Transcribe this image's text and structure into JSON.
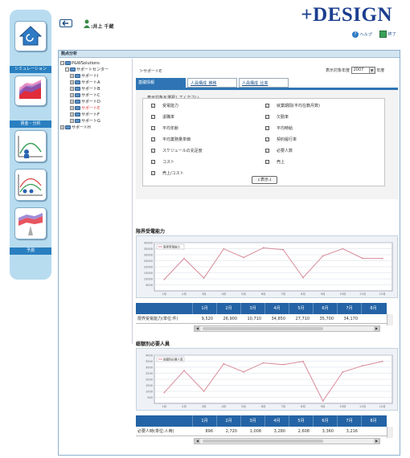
{
  "header": {
    "logo": "+DESIGN",
    "user_name": "井上 千蔵",
    "help_label": "ヘルプ",
    "exit_label": "終了"
  },
  "sidebar": {
    "simulation_label": "シミュレーション",
    "salary_label": "賃金・分析",
    "forecast_label": "予測"
  },
  "main": {
    "title": "拠点分析",
    "breadcrumb": "＞サポートE",
    "year_label": "表示対象年度",
    "year_value": "2007",
    "year_suffix": "年度"
  },
  "tree": {
    "root": "P&WSolutions",
    "center": "サポートセンター",
    "items": [
      "サポートI",
      "サポートA",
      "サポートB",
      "サポートC",
      "サポートD",
      "サポートE",
      "サポートF",
      "サポートG"
    ],
    "last": "サポートH"
  },
  "tabs": [
    "基礎情報",
    "人員構成_推移",
    "人員構成_比率"
  ],
  "options": {
    "legend": "表示対象を選択してください",
    "left": [
      "受電能力",
      "退職率",
      "平均年齢",
      "平均業務量単価",
      "スケジュールの充足度",
      "コスト",
      "売上/コスト"
    ],
    "right": [
      "就業期間(平均在籍月数)",
      "欠勤率",
      "平均時給",
      "契約履行率",
      "必要人数",
      "売上"
    ],
    "display_button": "↓表示↓"
  },
  "section1": {
    "title": "限界受電能力",
    "legend": "限界受電能力",
    "row_label": "限界受電能力(単位:件)"
  },
  "section2": {
    "title": "総額別必要人員",
    "legend": "総額別必要人員",
    "row_label": "必要人時(単位:人時)"
  },
  "months": [
    "1月",
    "2月",
    "3月",
    "4月",
    "5月",
    "6月",
    "7月",
    "8月"
  ],
  "colors": {
    "accent": "#2463a5",
    "line": "#d88a98",
    "logo": "#1b3e8f"
  },
  "chart_data": [
    {
      "type": "line",
      "title": "限界受電能力",
      "categories": [
        "1月",
        "2月",
        "3月",
        "4月",
        "5月",
        "6月",
        "7月",
        "8月",
        "9月",
        "10月",
        "11月",
        "12月"
      ],
      "values": [
        9520,
        26900,
        10710,
        34850,
        27710,
        35700,
        34170,
        11000,
        29000,
        35000,
        27000,
        26900
      ],
      "y_ticks": [
        5000,
        10000,
        15000,
        20000,
        25000,
        30000,
        35000,
        40000
      ],
      "ylim": [
        0,
        40000
      ],
      "table_values": [
        "9,520",
        "26,900",
        "10,710",
        "34,850",
        "27,710",
        "35,700",
        "34,170",
        ""
      ]
    },
    {
      "type": "line",
      "title": "総額別必要人員",
      "categories": [
        "1月",
        "2月",
        "3月",
        "4月",
        "5月",
        "6月",
        "7月",
        "8月",
        "9月",
        "10月",
        "11月",
        "12月"
      ],
      "values": [
        896,
        2720,
        1008,
        3280,
        2608,
        3360,
        3216,
        3480,
        200,
        2600,
        3120,
        3480
      ],
      "y_ticks": [
        500,
        1000,
        1500,
        2000,
        2500,
        3000,
        3500,
        4000
      ],
      "ylim": [
        0,
        4000
      ],
      "table_values": [
        "896",
        "2,720",
        "1,008",
        "3,280",
        "2,608",
        "3,360",
        "3,216",
        ""
      ]
    }
  ]
}
